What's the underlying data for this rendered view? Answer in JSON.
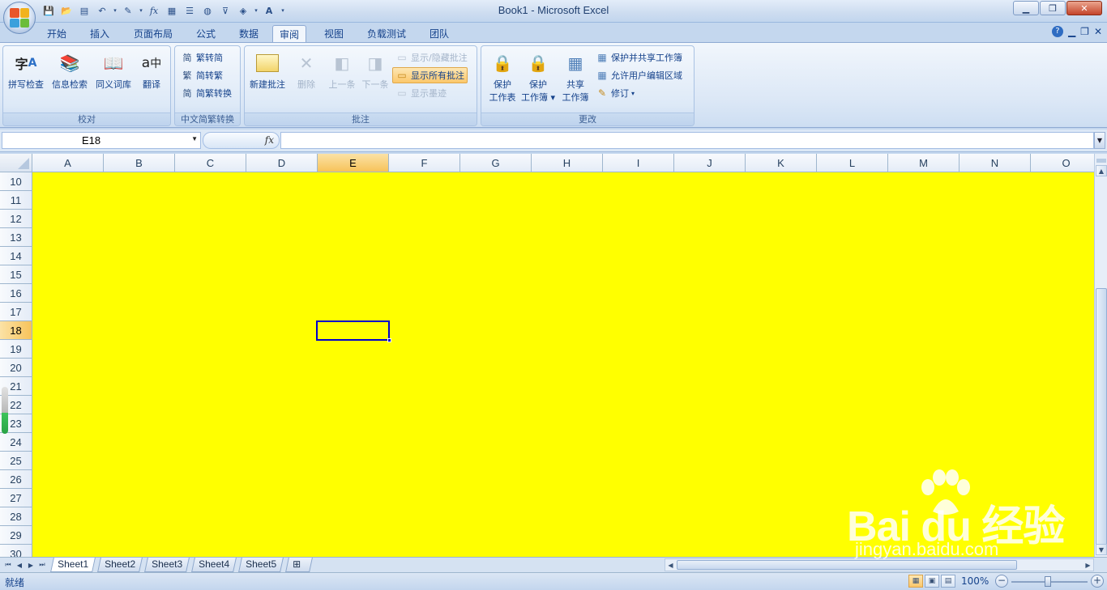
{
  "window": {
    "title": "Book1 - Microsoft Excel"
  },
  "tabs": [
    {
      "label": "开始"
    },
    {
      "label": "插入"
    },
    {
      "label": "页面布局"
    },
    {
      "label": "公式"
    },
    {
      "label": "数据"
    },
    {
      "label": "审阅",
      "active": true
    },
    {
      "label": "视图"
    },
    {
      "label": "负载测试"
    },
    {
      "label": "团队"
    }
  ],
  "ribbon": {
    "groups": {
      "proofing": {
        "label": "校对",
        "buttons": [
          "拼写检查",
          "信息检索",
          "同义词库",
          "翻译"
        ]
      },
      "chinese": {
        "label": "中文简繁转换",
        "buttons": [
          "繁转简",
          "简转繁",
          "简繁转换"
        ]
      },
      "comments": {
        "label": "批注",
        "new": "新建批注",
        "delete": "删除",
        "prev": "上一条",
        "next": "下一条",
        "show_hide": "显示/隐藏批注",
        "show_all": "显示所有批注",
        "show_ink": "显示墨迹"
      },
      "changes": {
        "label": "更改",
        "protect_sheet_1": "保护",
        "protect_sheet_2": "工作表",
        "protect_book_1": "保护",
        "protect_book_2": "工作簿",
        "share_book_1": "共享",
        "share_book_2": "工作簿",
        "protect_share": "保护并共享工作簿",
        "allow_edit": "允许用户编辑区域",
        "track": "修订"
      }
    }
  },
  "formula_bar": {
    "name_box": "E18",
    "fx": "fx",
    "formula": ""
  },
  "grid": {
    "columns": [
      "A",
      "B",
      "C",
      "D",
      "E",
      "F",
      "G",
      "H",
      "I",
      "J",
      "K",
      "L",
      "M",
      "N",
      "O"
    ],
    "rows": [
      "10",
      "11",
      "12",
      "13",
      "14",
      "15",
      "16",
      "17",
      "18",
      "19",
      "20",
      "21",
      "22",
      "23",
      "24",
      "25",
      "26",
      "27",
      "28",
      "29",
      "30"
    ],
    "selected_column": "E",
    "selected_row": "18",
    "fill_color": "#ffff00"
  },
  "sheets": [
    {
      "label": "Sheet1",
      "active": true
    },
    {
      "label": "Sheet2"
    },
    {
      "label": "Sheet3"
    },
    {
      "label": "Sheet4"
    },
    {
      "label": "Sheet5"
    }
  ],
  "status": {
    "text": "就绪",
    "zoom": "100%"
  },
  "watermark": {
    "logo": "Bai du 经验",
    "url": "jingyan.baidu.com"
  }
}
